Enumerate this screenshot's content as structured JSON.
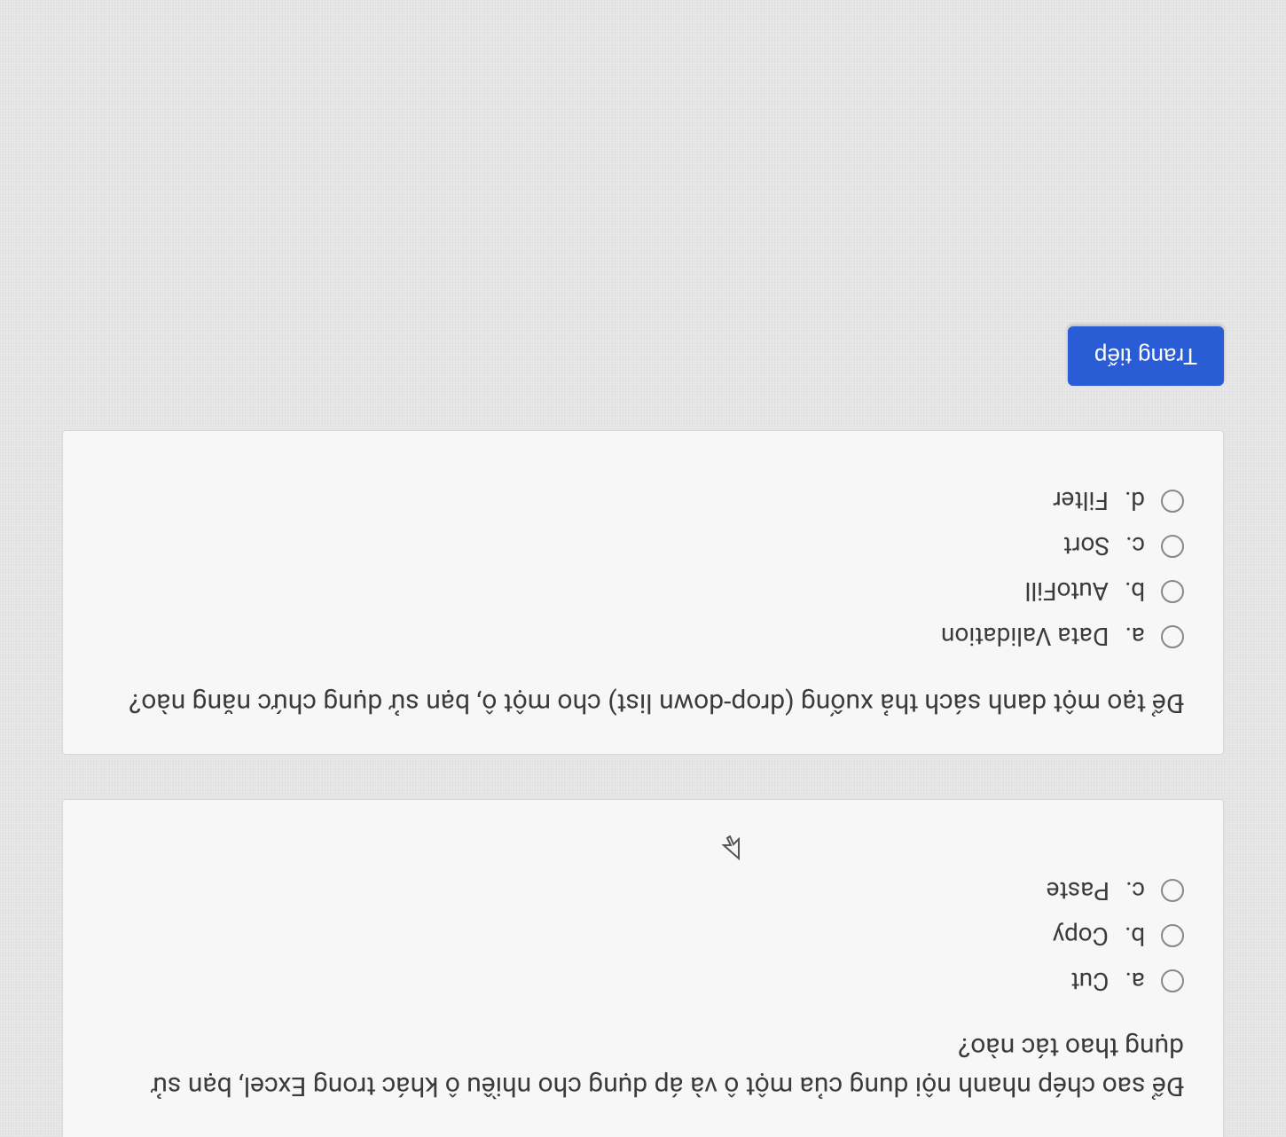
{
  "questions": {
    "q1": {
      "text": "Để sao chép nhanh nội dung của một ô và áp dụng cho nhiều ô khác trong Excel, bạn sử dụng thao tác nào?",
      "options": {
        "a": {
          "letter": "a.",
          "label": "Cut"
        },
        "b": {
          "letter": "b.",
          "label": "Copy"
        },
        "c": {
          "letter": "c.",
          "label": "Paste"
        }
      }
    },
    "q2": {
      "text": "Để tạo một danh sách thả xuống (drop-down list) cho một ô, bạn sử dụng chức năng nào?",
      "options": {
        "a": {
          "letter": "a.",
          "label": "Data Validation"
        },
        "b": {
          "letter": "b.",
          "label": "AutoFill"
        },
        "c": {
          "letter": "c.",
          "label": "Sort"
        },
        "d": {
          "letter": "d.",
          "label": "Filter"
        }
      }
    }
  },
  "nav": {
    "next_label": "Trang tiếp"
  }
}
